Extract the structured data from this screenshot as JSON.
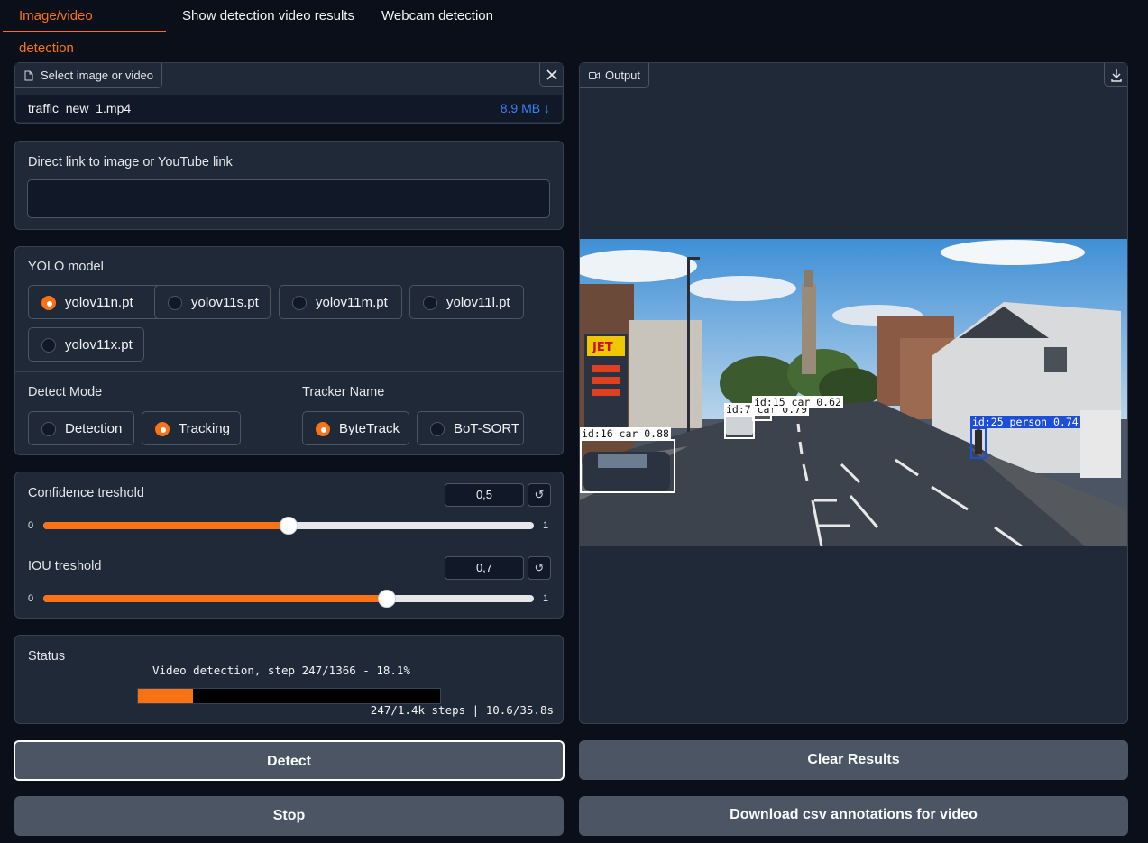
{
  "tabs": [
    {
      "label": "Image/video detection",
      "active": true
    },
    {
      "label": "Show detection video results",
      "active": false
    },
    {
      "label": "Webcam detection",
      "active": false
    }
  ],
  "file_input": {
    "label": "Select image or video",
    "icon": "file-icon",
    "file_name": "traffic_new_1.mp4",
    "file_size": "8.9 MB ↓",
    "clear_icon": "close-icon"
  },
  "link_input": {
    "label": "Direct link to image or YouTube link",
    "value": "",
    "placeholder": ""
  },
  "yolo_model": {
    "label": "YOLO model",
    "options": [
      "yolov11n.pt",
      "yolov11s.pt",
      "yolov11m.pt",
      "yolov11l.pt",
      "yolov11x.pt"
    ],
    "selected": "yolov11n.pt"
  },
  "detect_mode": {
    "label": "Detect Mode",
    "options": [
      "Detection",
      "Tracking"
    ],
    "selected": "Tracking"
  },
  "tracker": {
    "label": "Tracker Name",
    "options": [
      "ByteTrack",
      "BoT-SORT"
    ],
    "selected": "ByteTrack"
  },
  "confidence": {
    "label": "Confidence treshold",
    "value": "0,5",
    "level": 0.5,
    "min": "0",
    "max": "1",
    "reset_icon": "reset-icon"
  },
  "iou": {
    "label": "IOU treshold",
    "value": "0,7",
    "level": 0.7,
    "min": "0",
    "max": "1",
    "reset_icon": "reset-icon"
  },
  "status": {
    "label": "Status",
    "message": "Video detection, step 247/1366 - 18.1%",
    "progress": 0.181,
    "steps": "247/1.4k steps | 10.6/35.8s"
  },
  "output": {
    "label": "Output",
    "icon": "video-icon",
    "download_icon": "download-icon",
    "detections": [
      {
        "label": "id:16 car 0.88",
        "color": "#ffffff"
      },
      {
        "label": "id:7 car 0.79",
        "color": "#ffffff"
      },
      {
        "label": "id:15 car 0.62",
        "color": "#ffffff"
      },
      {
        "label": "id:25 person 0.74",
        "color": "#1d4ed8"
      }
    ]
  },
  "buttons": {
    "detect": "Detect",
    "stop": "Stop",
    "clear": "Clear Results",
    "download_csv": "Download csv annotations for video"
  },
  "colors": {
    "accent": "#f97316",
    "background": "#0b0f19",
    "panel": "#1f2937",
    "button": "#4b5563"
  }
}
